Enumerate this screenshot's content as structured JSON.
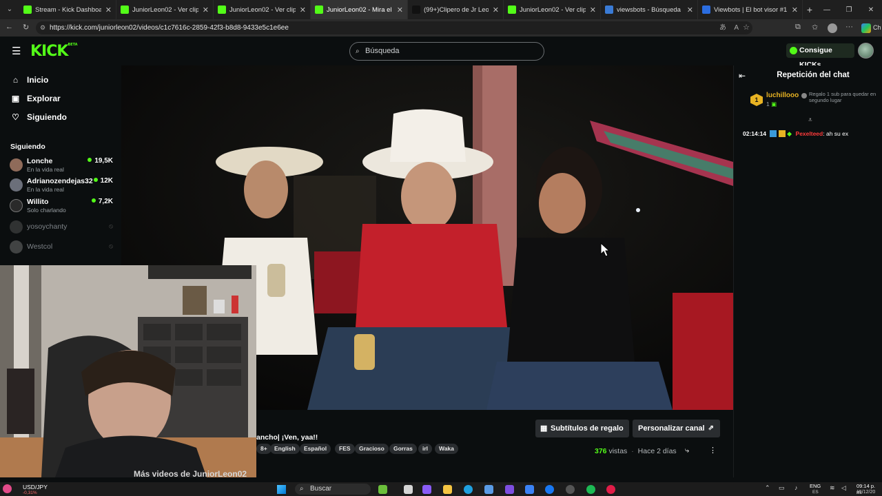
{
  "browser": {
    "tabs": [
      {
        "label": "Stream - Kick Dashboard",
        "color": "#53fc18"
      },
      {
        "label": "JuniorLeon02 - Ver clips en K",
        "color": "#53fc18"
      },
      {
        "label": "JuniorLeon02 - Ver clips en K",
        "color": "#53fc18"
      },
      {
        "label": "JuniorLeon02 - Mira el V",
        "color": "#53fc18",
        "active": true
      },
      {
        "label": "(99+)Clipero de Jr Leon (@c",
        "color": "#111111"
      },
      {
        "label": "JuniorLeon02 - Ver clips en K",
        "color": "#53fc18"
      },
      {
        "label": "viewsbots - Búsqueda",
        "color": "#3a7bd5"
      },
      {
        "label": "Viewbots | El bot visor #1 de",
        "color": "#2b6de0"
      }
    ],
    "url": "https://kick.com/juniorleon02/videos/c1c7616c-2859-42f3-b8d8-9433e5c1e6ee",
    "profile_short": "Ch"
  },
  "header": {
    "logo": "KICK",
    "logo_badge": "BETA",
    "search_placeholder": "Búsqueda",
    "kicks_button": "Consigue KICKs"
  },
  "sidebar": {
    "nav": [
      {
        "label": "Inicio",
        "icon": "home-icon"
      },
      {
        "label": "Explorar",
        "icon": "compass-icon"
      },
      {
        "label": "Siguiendo",
        "icon": "heart-icon"
      }
    ],
    "following_heading": "Siguiendo",
    "channels": [
      {
        "name": "Lonche",
        "category": "En la vida real",
        "viewers": "19,5K",
        "live": true,
        "color": "#8f6b5a"
      },
      {
        "name": "Adrianozendejas32",
        "category": "En la vida real",
        "viewers": "12K",
        "live": true,
        "color": "#6b6f7a"
      },
      {
        "name": "Willito",
        "category": "Solo charlando",
        "viewers": "7,2K",
        "live": true,
        "color": "#2a2a2a"
      },
      {
        "name": "yosoychanty",
        "live": false,
        "color": "#555555"
      },
      {
        "name": "Westcol",
        "live": false,
        "color": "#777777"
      }
    ]
  },
  "video_info": {
    "gift_subs_button": "Subtítulos de regalo",
    "customize_button": "Personalizar canal",
    "title_fragment": "ancho| ¡Ven, yaa!!",
    "tags": [
      "8+",
      "English",
      "Español",
      "FES",
      "Gracioso",
      "Gorras",
      "irl",
      "Waka"
    ],
    "views_count": "376",
    "views_label": "vistas",
    "age": "Hace 2 días",
    "more_clips": "Más videos de JuniorLeon02"
  },
  "chat": {
    "title": "Repetición del chat",
    "gift": {
      "rank": "1",
      "user": "luchillooo",
      "count": "1",
      "note": "Regalo 1 sub para quedar en segundo lugar"
    },
    "messages": [
      {
        "time": "02:14:14",
        "user": "Pexelteed",
        "text": "ah su ex",
        "user_color": "#ff3b3b"
      }
    ]
  },
  "taskbar": {
    "ticker_label": "USD/JPY",
    "ticker_change": "-0,31%",
    "search_label": "Buscar",
    "lang": "ENG",
    "lang_sub": "ES",
    "time": "09:14 p. m.",
    "date": "15/12/20"
  }
}
